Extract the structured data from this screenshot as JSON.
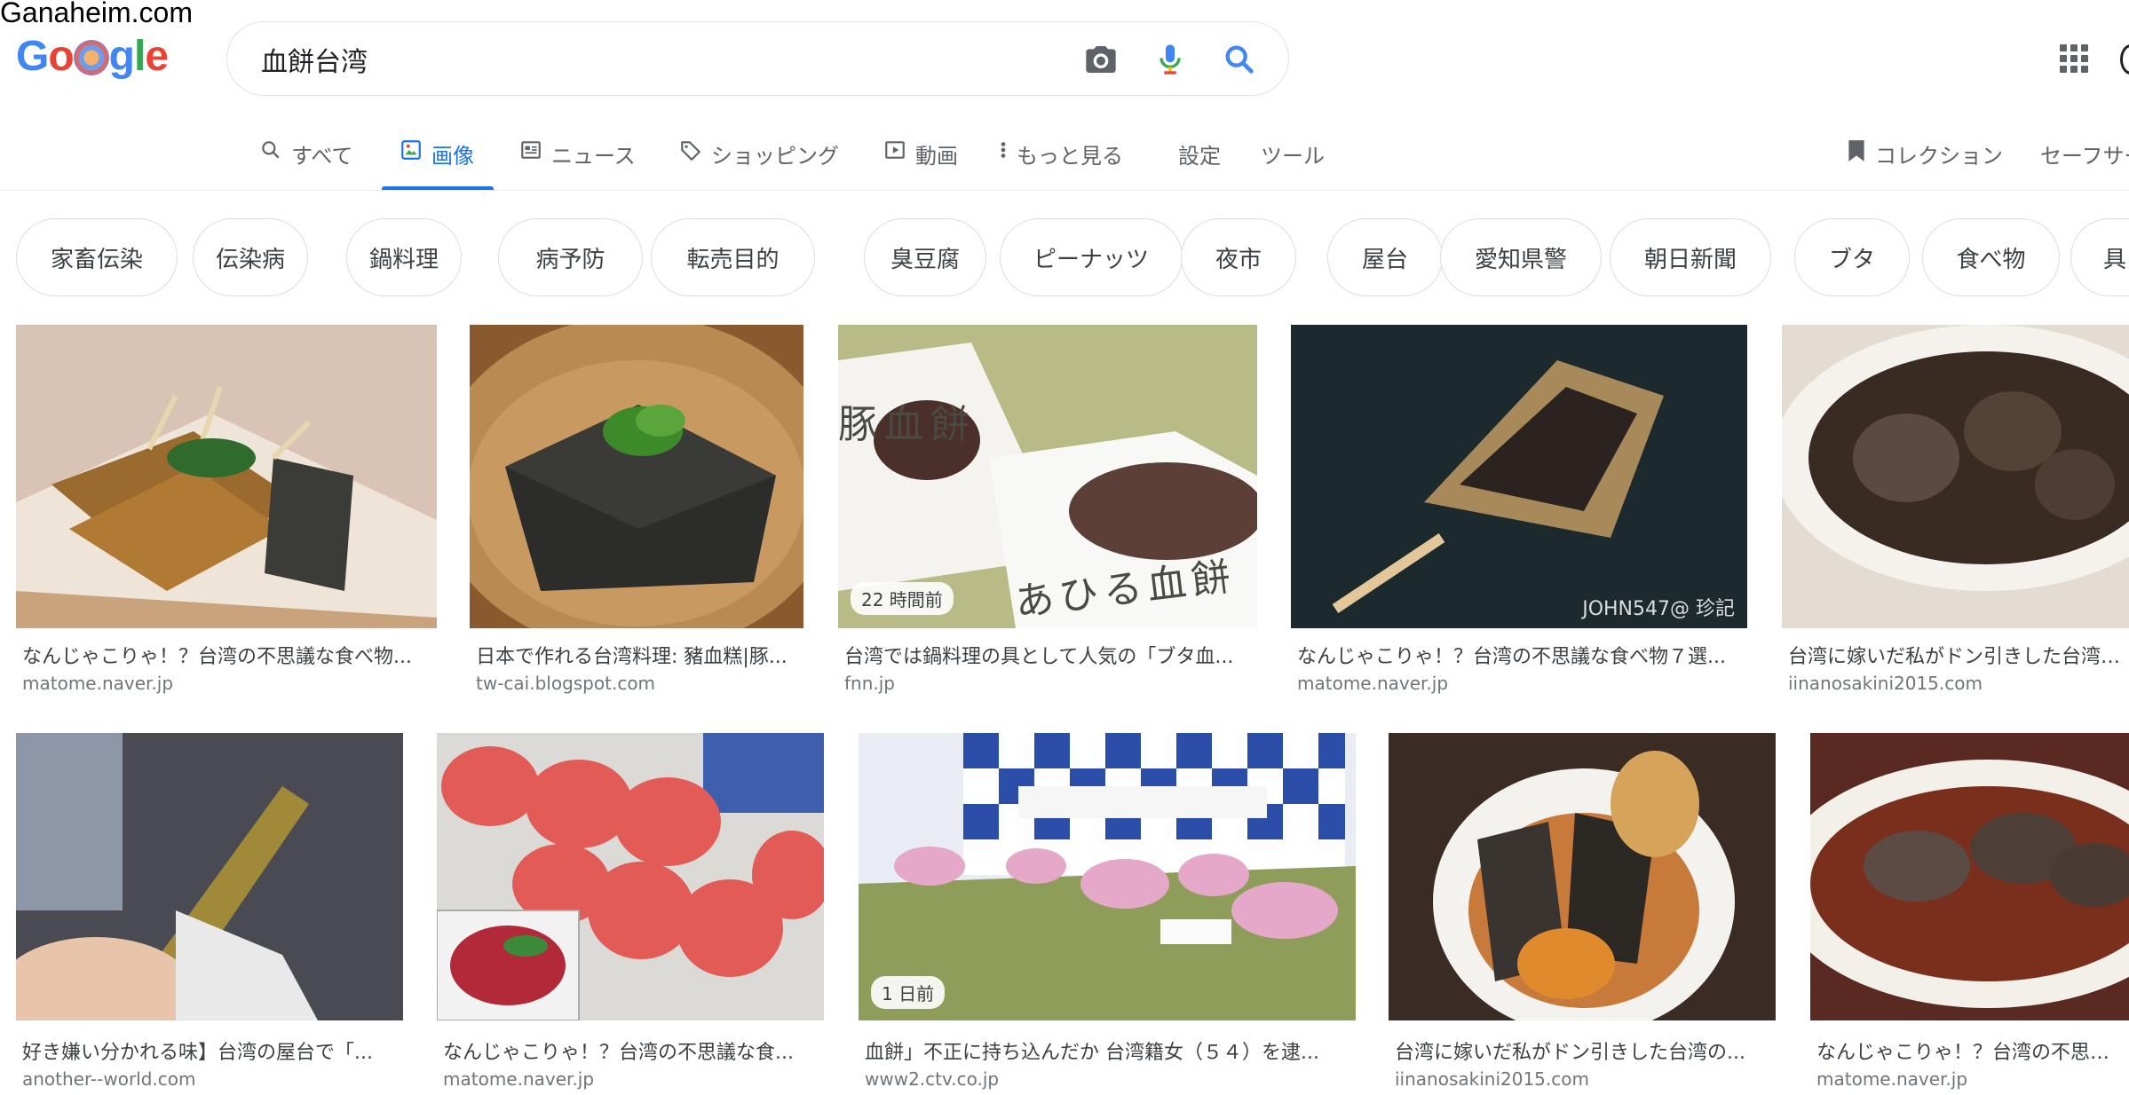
{
  "site_label": "Ganaheim.com",
  "logo": {
    "letters": [
      "G",
      "o",
      "g",
      "l",
      "e"
    ]
  },
  "search": {
    "query": "血餅台湾"
  },
  "tabs": [
    {
      "label": "すべて",
      "icon": "search-icon"
    },
    {
      "label": "画像",
      "icon": "image-icon",
      "active": true
    },
    {
      "label": "ニュース",
      "icon": "news-icon"
    },
    {
      "label": "ショッピング",
      "icon": "tag-icon"
    },
    {
      "label": "動画",
      "icon": "video-icon"
    },
    {
      "label": "もっと見る",
      "icon": "more-vert-icon"
    },
    {
      "label": "設定"
    },
    {
      "label": "ツール"
    }
  ],
  "right_tabs": {
    "collections": "コレクション",
    "safesearch": "セーフサーチ"
  },
  "chips": [
    "家畜伝染",
    "伝染病",
    "鍋料理",
    "病予防",
    "転売目的",
    "臭豆腐",
    "ピーナッツ",
    "夜市",
    "屋台",
    "愛知県警",
    "朝日新聞",
    "ブタ",
    "食べ物",
    "具"
  ],
  "results_row1": [
    {
      "caption": "なんじゃこりゃ！？台湾の不思議な食べ物...",
      "source": "matome.naver.jp"
    },
    {
      "caption": "日本で作れる台湾料理: 豬血糕|豚...",
      "source": "tw-cai.blogspot.com"
    },
    {
      "caption": "台湾では鍋料理の具として人気の「ブタ血...",
      "source": "fnn.jp",
      "badge": "22 時間前",
      "image_text": [
        "豚血餅",
        "あひる血餅"
      ]
    },
    {
      "caption": "なんじゃこりゃ！？台湾の不思議な食べ物７選...",
      "source": "matome.naver.jp",
      "image_text": [
        "JOHN547@ 珍記"
      ]
    },
    {
      "caption": "台湾に嫁いだ私がドン引きした台湾の...",
      "source": "iinanosakini2015.com"
    }
  ],
  "results_row2": [
    {
      "caption": "好き嫌い分かれる味】台湾の屋台で「...",
      "source": "another--world.com"
    },
    {
      "caption": "なんじゃこりゃ！？台湾の不思議な食...",
      "source": "matome.naver.jp"
    },
    {
      "caption": "血餅」不正に持ち込んだか 台湾籍女（５４）を逮...",
      "source": "www2.ctv.co.jp",
      "badge": "1 日前"
    },
    {
      "caption": "台湾に嫁いだ私がドン引きした台湾の...",
      "source": "iinanosakini2015.com"
    },
    {
      "caption": "なんじゃこりゃ！？台湾の不思議な食...",
      "source": "matome.naver.jp"
    }
  ]
}
